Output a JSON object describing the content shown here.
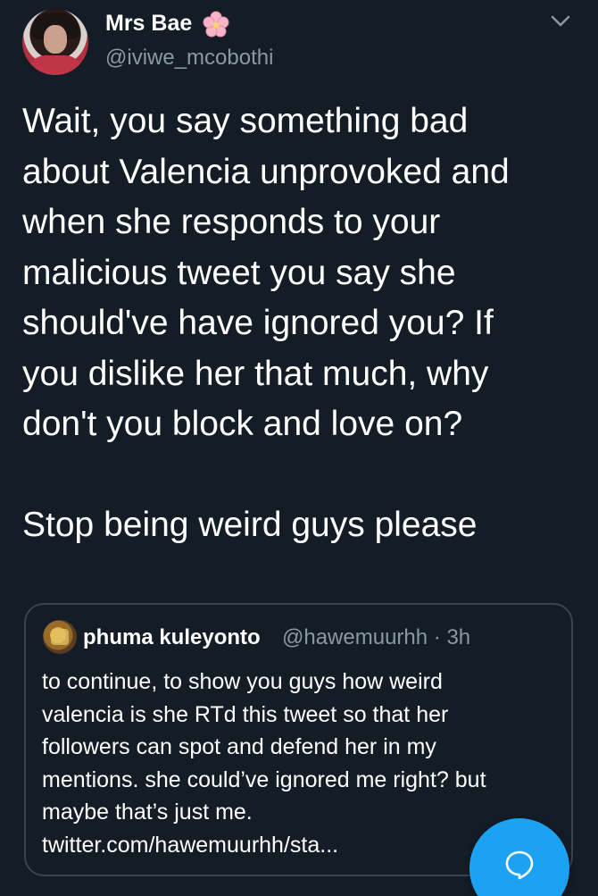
{
  "author": {
    "display_name": "Mrs Bae",
    "display_name_emoji": "cherry-blossom-icon",
    "handle": "@iviwe_mcobothi"
  },
  "tweet": {
    "text_paragraph_1": "Wait, you say something bad\nabout Valencia unprovoked and\nwhen she responds to your\nmalicious tweet you say she\nshould've have ignored you? If\nyou dislike her that much, why\ndon't you block and love on?",
    "text_paragraph_2": "Stop being weird guys please"
  },
  "quoted_tweet": {
    "display_name": "phuma kuleyonto",
    "handle_and_time": "@hawemuurhh · 3h",
    "text": "to continue, to show you guys how weird\nvalencia is she RTd this tweet so that her\nfollowers can spot and defend her in my\nmentions. she could’ve ignored me right? but\nmaybe that’s just me.\ntwitter.com/hawemuurhh/sta..."
  },
  "icons": {
    "menu": "chevron-down-icon",
    "compose": "compose-message-icon"
  },
  "colors": {
    "background": "#141d26",
    "secondary_text": "#8899a6",
    "accent": "#1da1f2",
    "border": "#38444d"
  }
}
